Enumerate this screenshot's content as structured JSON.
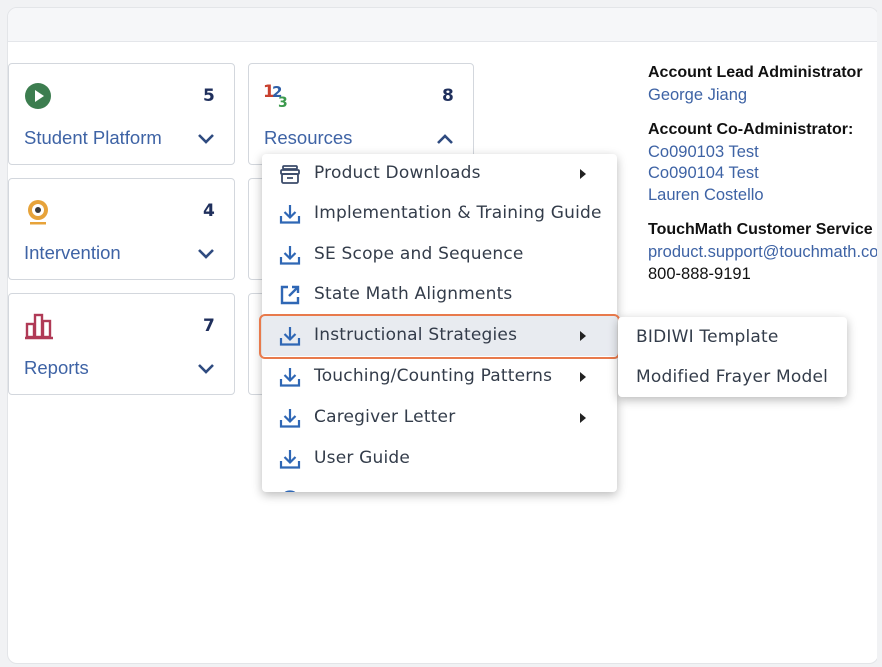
{
  "cards": [
    {
      "label": "Student Platform",
      "count": "5",
      "icon": "play-circle-icon"
    },
    {
      "label": "Resources",
      "count": "8",
      "icon": "numbers-123-icon"
    },
    {
      "label": "Intervention",
      "count": "4",
      "icon": "target-icon"
    },
    {
      "label": "Reports",
      "count": "7",
      "icon": "bar-chart-icon"
    }
  ],
  "menu": {
    "items": [
      {
        "label": "Product Downloads",
        "icon": "archive-box-icon",
        "has_submenu": true
      },
      {
        "label": "Implementation & Training Guide",
        "icon": "download-icon",
        "has_submenu": false
      },
      {
        "label": "SE Scope and Sequence",
        "icon": "download-icon",
        "has_submenu": false
      },
      {
        "label": "State Math Alignments",
        "icon": "external-link-icon",
        "has_submenu": false
      },
      {
        "label": "Instructional Strategies",
        "icon": "download-icon",
        "has_submenu": true,
        "highlighted": true
      },
      {
        "label": "Touching/Counting Patterns",
        "icon": "download-icon",
        "has_submenu": true
      },
      {
        "label": "Caregiver Letter",
        "icon": "download-icon",
        "has_submenu": true
      },
      {
        "label": "User Guide",
        "icon": "download-icon",
        "has_submenu": false
      }
    ]
  },
  "submenu": {
    "items": [
      {
        "label": "BIDIWI Template"
      },
      {
        "label": "Modified Frayer Model"
      }
    ]
  },
  "account": {
    "lead_heading": "Account Lead Administrator",
    "lead_name": "George Jiang",
    "co_heading": "Account Co-Administrator:",
    "co_names": [
      "Co090103 Test",
      "Co090104 Test",
      "Lauren Costello"
    ],
    "service_heading": "TouchMath Customer Service",
    "service_email": "product.support@touchmath.com",
    "service_phone": "800-888-9191"
  },
  "colors": {
    "accent": "#3e63a5",
    "highlight_border": "#e87a4c",
    "count_text": "#1f2f5c"
  }
}
